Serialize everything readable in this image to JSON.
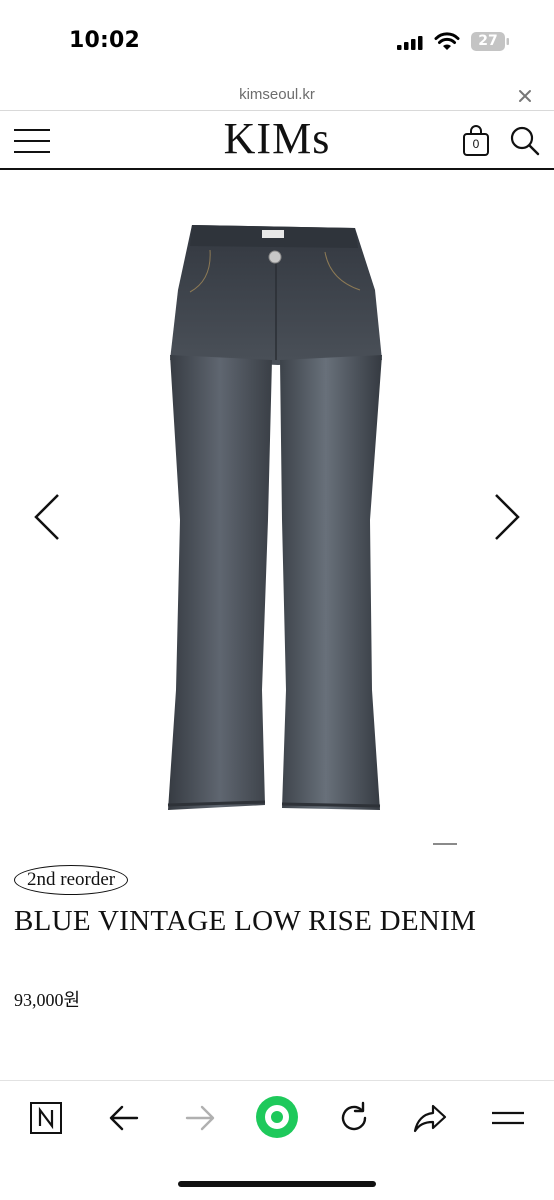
{
  "status_bar": {
    "time": "10:02",
    "battery_level": "27",
    "icons": [
      "signal-icon",
      "wifi-icon",
      "battery-icon"
    ]
  },
  "browser": {
    "url": "kimseoul.kr",
    "close_icon": "close-icon"
  },
  "header": {
    "logo": "KIMs",
    "cart_count": "0",
    "icons": [
      "hamburger-menu-icon",
      "shopping-bag-icon",
      "search-icon"
    ]
  },
  "gallery": {
    "prev_icon": "chevron-left-icon",
    "next_icon": "chevron-right-icon",
    "image_subject": "flared dark wash jeans"
  },
  "product": {
    "badge": "2nd reorder",
    "name": "BLUE VINTAGE LOW RISE DENIM",
    "price": "93,000원"
  },
  "toolbar": {
    "items": [
      "naver-n-icon",
      "back-arrow-icon",
      "forward-arrow-icon",
      "green-home-icon",
      "reload-icon",
      "share-icon",
      "menu-icon"
    ]
  },
  "colors": {
    "accent_green": "#1ec95b",
    "text": "#111111",
    "denim_dark": "#3b4149",
    "denim_light": "#646c76"
  }
}
